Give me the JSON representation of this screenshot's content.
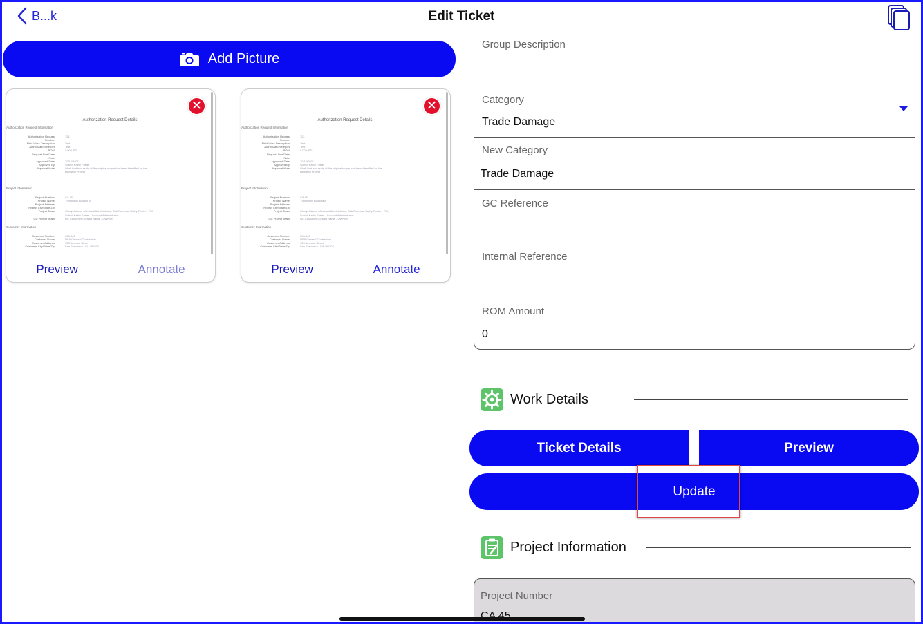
{
  "header": {
    "back_label": "B...k",
    "title": "Edit Ticket",
    "copy_icon": "copy-icon"
  },
  "add_picture": {
    "label": "Add Picture",
    "icon": "camera-icon"
  },
  "attachments": [
    {
      "preview_label": "Preview",
      "annotate_label": "Annotate",
      "annotate_state": "dimmed",
      "delete_icon": "close-icon"
    },
    {
      "preview_label": "Preview",
      "annotate_label": "Annotate",
      "annotate_state": "active",
      "delete_icon": "close-icon"
    }
  ],
  "doc_thumb": {
    "title": "Authorization Request Details",
    "section1": "Authorization Request Information",
    "rows1": [
      {
        "k": "Authorization Request",
        "v": "113"
      },
      {
        "k": "Number:",
        "v": ""
      },
      {
        "k": "Field Work Description:",
        "v": "Test"
      },
      {
        "k": "Authorization Report:",
        "v": "Test"
      },
      {
        "k": "ROM:",
        "v": "0.00 USD"
      },
      {
        "k": "Request Due Date:",
        "v": ""
      },
      {
        "k": "Note:",
        "v": ""
      },
      {
        "k": "Approved Date:",
        "v": "10/15/2021"
      },
      {
        "k": "Approved By:",
        "v": "Sub/M Kathy Foster"
      },
      {
        "k": "Approval Note:",
        "v": "Work that is outside of the original scope has been identified on the"
      },
      {
        "k": "",
        "v": "following Project"
      }
    ],
    "section2": "Project Information",
    "rows2": [
      {
        "k": "Project Number:",
        "v": "CA 45"
      },
      {
        "k": "Project Name:",
        "v": "Thompson Building A"
      },
      {
        "k": "Project Address:",
        "v": ""
      },
      {
        "k": "Project City/State/Zip:",
        "v": ""
      },
      {
        "k": "Project Team:",
        "v": "Cheryl Adams - Account Administrator, Sub/Foreman Kathy Foster - PM,"
      },
      {
        "k": "",
        "v": "Sub/M Kathy Foster - Account Administrator"
      },
      {
        "k": "GC Project Team:",
        "v": "UC Customer Contact Name - OWNER"
      }
    ],
    "section3": "Customer Information",
    "rows3": [
      {
        "k": "Customer Number:",
        "v": "000-000"
      },
      {
        "k": "Customer Name:",
        "v": "USA General Contractors"
      },
      {
        "k": "Customer Address:",
        "v": "123 America Street"
      },
      {
        "k": "Customer City/State/Zip:",
        "v": "San Francisco / CA / 94104"
      }
    ]
  },
  "form": {
    "group_description": {
      "label": "Group Description",
      "value": ""
    },
    "category": {
      "label": "Category",
      "value": "Trade Damage"
    },
    "new_category": {
      "label": "New Category",
      "value": "Trade Damage"
    },
    "gc_reference": {
      "label": "GC Reference",
      "value": ""
    },
    "internal_reference": {
      "label": "Internal Reference",
      "value": ""
    },
    "rom_amount": {
      "label": "ROM Amount",
      "value": "0"
    }
  },
  "work_details": {
    "heading": "Work Details",
    "icon": "gear-wrench-icon",
    "ticket_details_label": "Ticket Details",
    "preview_label": "Preview",
    "update_label": "Update"
  },
  "project_information": {
    "heading": "Project Information",
    "icon": "clipboard-icon",
    "project_number": {
      "label": "Project Number",
      "value": "CA 45"
    }
  },
  "colors": {
    "primary": "#0a0af2",
    "link": "#1a1ab8",
    "delete": "#e2102c",
    "highlight": "#e04848",
    "icon_green": "#5ec46a",
    "readonly_bg": "#dcdadd"
  }
}
